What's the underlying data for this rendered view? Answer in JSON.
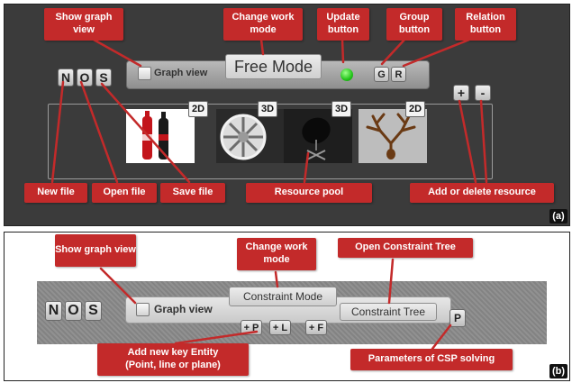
{
  "panel_a": {
    "tag": "(a)",
    "keys": {
      "new": "N",
      "open": "O",
      "save": "S"
    },
    "graph_view_label": "Graph view",
    "mode_label": "Free Mode",
    "group_key": "G",
    "relation_key": "R",
    "add_key": "+",
    "delete_key": "-",
    "resources": [
      {
        "badge": "2D",
        "icon": "bottles"
      },
      {
        "badge": "3D",
        "icon": "wheel-rim"
      },
      {
        "badge": "3D",
        "icon": "chair"
      },
      {
        "badge": "2D",
        "icon": "antlers"
      }
    ],
    "callouts": {
      "show_graph": "Show graph view",
      "change_mode": "Change work mode",
      "update": "Update button",
      "group": "Group button",
      "relation": "Relation button",
      "new_file": "New file",
      "open_file": "Open file",
      "save_file": "Save file",
      "resource_pool": "Resource pool",
      "add_delete": "Add or delete resource"
    }
  },
  "panel_b": {
    "tag": "(b)",
    "keys": {
      "new": "N",
      "open": "O",
      "save": "S"
    },
    "graph_view_label": "Graph view",
    "mode_label": "Constraint Mode",
    "tree_label": "Constraint Tree",
    "entity_keys": [
      "+ P",
      "+ L",
      "+ F"
    ],
    "param_key": "P",
    "callouts": {
      "show_graph": "Show graph view",
      "change_mode": "Change work mode",
      "open_tree": "Open Constraint Tree",
      "add_entity_line1": "Add new key Entity",
      "add_entity_line2": "(Point, line or plane)",
      "csp": "Parameters of CSP solving"
    }
  },
  "colors": {
    "callout": "#c32a2a",
    "update_indicator": "#23c41a"
  }
}
